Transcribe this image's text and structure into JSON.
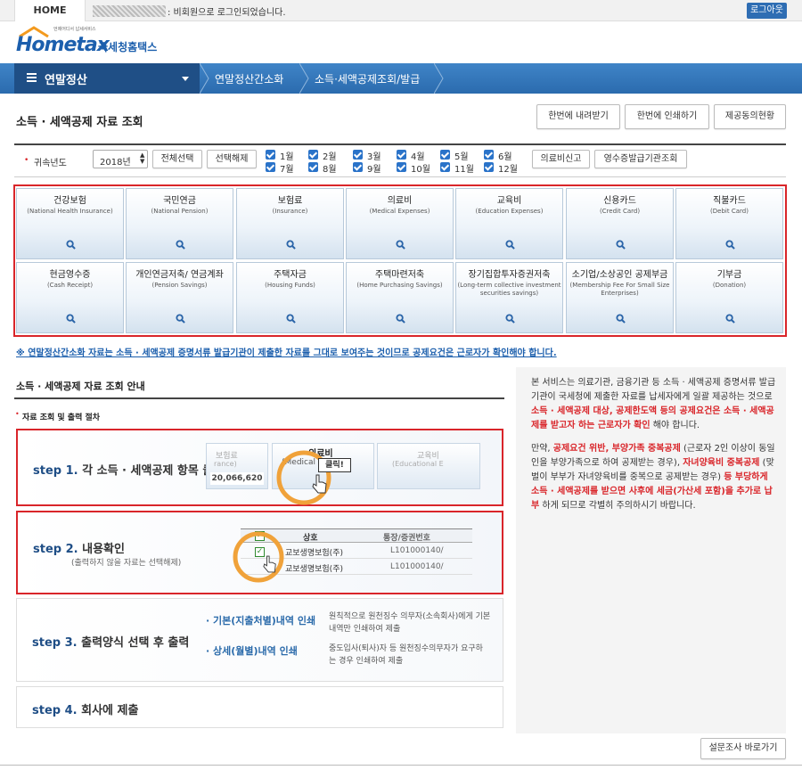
{
  "top": {
    "home": "HOME",
    "login_msg": ": 비회원으로 로그인되었습니다.",
    "logout": "로그아웃"
  },
  "logo": {
    "tagline": "언제어디서 납세서비스",
    "brand": "Hometax",
    "korean": "국세청홈택스"
  },
  "nav": {
    "main": "연말정산",
    "crumb1": "연말정산간소화",
    "crumb2": "소득·세액공제조회/발급"
  },
  "page": {
    "title": "소득 · 세액공제 자료 조회",
    "buttons": [
      "한번에 내려받기",
      "한번에 인쇄하기",
      "제공동의현황"
    ]
  },
  "filter": {
    "year_label": "귀속년도",
    "year": "2018년",
    "select_all": "전체선택",
    "deselect": "선택해제",
    "months": [
      "1월",
      "2월",
      "3월",
      "4월",
      "5월",
      "6월",
      "7월",
      "8월",
      "9월",
      "10월",
      "11월",
      "12월"
    ],
    "medical": "의료비신고",
    "receipt_org": "영수증발급기관조회"
  },
  "categories": [
    {
      "title": "건강보험",
      "sub": "(National Health Insurance)"
    },
    {
      "title": "국민연금",
      "sub": "(National Pension)"
    },
    {
      "title": "보험료",
      "sub": "(Insurance)"
    },
    {
      "title": "의료비",
      "sub": "(Medical Expenses)"
    },
    {
      "title": "교육비",
      "sub": "(Education Expenses)"
    },
    {
      "title": "신용카드",
      "sub": "(Credit Card)"
    },
    {
      "title": "직불카드",
      "sub": "(Debit Card)"
    },
    {
      "title": "현금영수증",
      "sub": "(Cash Receipt)"
    },
    {
      "title": "개인연금저축/ 연금계좌",
      "sub": "(Pension Savings)"
    },
    {
      "title": "주택자금",
      "sub": "(Housing Funds)"
    },
    {
      "title": "주택마련저축",
      "sub": "(Home Purchasing Savings)"
    },
    {
      "title": "장기집합투자증권저축",
      "sub": "(Long-term collective investment securities savings)"
    },
    {
      "title": "소기업/소상공인 공제부금",
      "sub": "(Membership Fee For Small Size Enterprises)"
    },
    {
      "title": "기부금",
      "sub": "(Donation)"
    }
  ],
  "notice": "※ 연말정산간소화 자료는 소득 · 세액공제 증명서류 발급기관이 제출한 자료를 그대로 보여주는 것이므로 공제요건은 근로자가 확인해야 합니다.",
  "guide": {
    "title": "소득 · 세액공제 자료 조회 안내",
    "proc": "자료 조회 및 출력 절차",
    "step1": {
      "num": "step 1.",
      "text": "각 소득 · 세액공제 항목 클릭",
      "card_left_a": "보험료",
      "card_left_b": "rance)",
      "amount": "20,066,620",
      "card_mid_a": "의료비",
      "card_mid_b": "(Medical E",
      "tooltip": "클릭!",
      "card_right_a": "교육비",
      "card_right_b": "(Educational E"
    },
    "step2": {
      "num": "step 2.",
      "text": "내용확인",
      "sub": "(출력하지 않을 자료는 선택해제)",
      "col1": "상호",
      "col2": "통장/증권번호",
      "row1": "교보생명보험(주)",
      "row1b": "L101000140/",
      "row2": "교보생명보험(주)",
      "row2b": "L101000140/"
    },
    "step3": {
      "num": "step 3.",
      "text": "출력양식 선택 후 출력",
      "opt1": "· 기본(지출처별)내역 인쇄",
      "opt1d": "원칙적으로 원천징수 의무자(소속회사)에게 기본내역만 인쇄하여 제출",
      "opt2": "· 상세(월별)내역 인쇄",
      "opt2d": "중도입사(퇴사)자 등 원천징수의무자가 요구하는 경우 인쇄하여 제출"
    },
    "step4": {
      "num": "step 4.",
      "text": "회사에 제출"
    }
  },
  "right": {
    "p1a": "본 서비스는 의료기관, 금융기관 등 소득 · 세액공제 증명서류 발급기관이 국세청에 제출한 자료를 납세자에게 일괄 제공하는 것으로 ",
    "p1b": "소득 · 세액공제 대상, 공제한도액 등의 공제요건은 소득 · 세액공제를 받고자 하는 근로자가 확인",
    "p1c": " 해야 합니다.",
    "p2a": "만약, ",
    "p2b": "공제요건 위반, 부양가족 중복공제",
    "p2c": " (근로자 2인 이상이 동일인을 부양가족으로 하여 공제받는 경우), ",
    "p2d": "자녀양육비 중복공제",
    "p2e": " (맞벌이 부부가 자녀양육비를 중복으로 공제받는 경우) ",
    "p2f": "등 부당하게 소득 · 세액공제를 받으면 사후에 세금(가산세 포함)을 추가로 납부",
    "p2g": " 하게 되므로 각별히 주의하시기 바랍니다."
  },
  "survey": "설문조사 바로가기"
}
